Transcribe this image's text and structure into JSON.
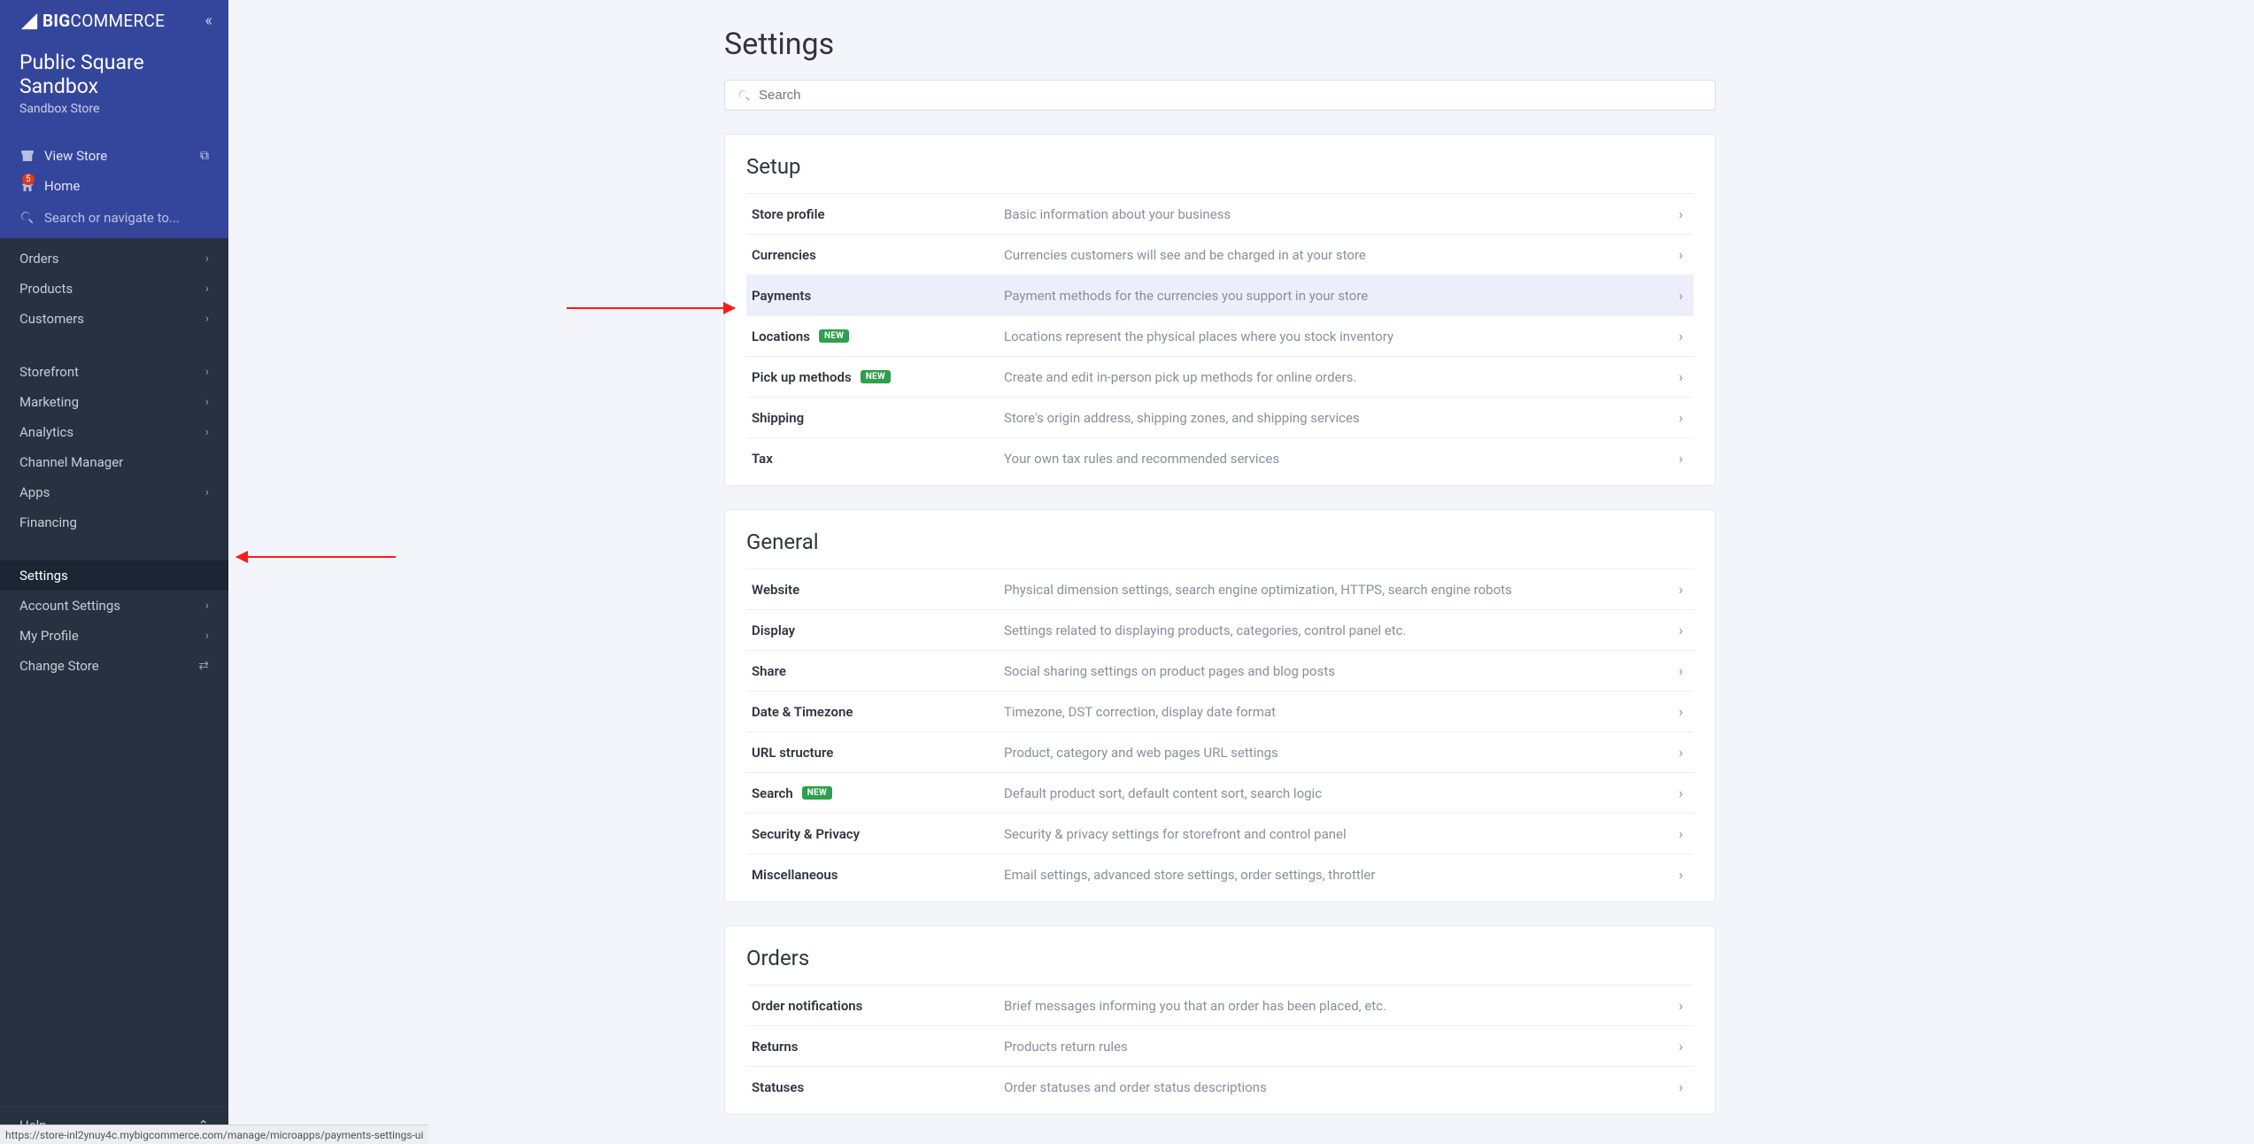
{
  "brand": {
    "big": "BIG",
    "commerce": "COMMERCE"
  },
  "store": {
    "title": "Public Square Sandbox",
    "sub": "Sandbox Store"
  },
  "side_links": {
    "view_store": "View Store",
    "home": "Home",
    "home_badge": "5",
    "search_placeholder": "Search or navigate to..."
  },
  "nav_group1": [
    {
      "label": "Orders",
      "expandable": true
    },
    {
      "label": "Products",
      "expandable": true
    },
    {
      "label": "Customers",
      "expandable": true
    }
  ],
  "nav_group2": [
    {
      "label": "Storefront",
      "expandable": true
    },
    {
      "label": "Marketing",
      "expandable": true
    },
    {
      "label": "Analytics",
      "expandable": true
    },
    {
      "label": "Channel Manager",
      "expandable": false
    },
    {
      "label": "Apps",
      "expandable": true
    },
    {
      "label": "Financing",
      "expandable": false
    }
  ],
  "nav_group3": [
    {
      "label": "Settings",
      "expandable": false,
      "active": true
    },
    {
      "label": "Account Settings",
      "expandable": true
    },
    {
      "label": "My Profile",
      "expandable": true
    },
    {
      "label": "Change Store",
      "expandable": false,
      "swap": true
    }
  ],
  "help_label": "Help",
  "page_title": "Settings",
  "search_placeholder": "Search",
  "sections": [
    {
      "title": "Setup",
      "rows": [
        {
          "label": "Store profile",
          "desc": "Basic information about your business"
        },
        {
          "label": "Currencies",
          "desc": "Currencies customers will see and be charged in at your store"
        },
        {
          "label": "Payments",
          "desc": "Payment methods for the currencies you support in your store",
          "highlight": true
        },
        {
          "label": "Locations",
          "desc": "Locations represent the physical places where you stock inventory",
          "new": true
        },
        {
          "label": "Pick up methods",
          "desc": "Create and edit in-person pick up methods for online orders.",
          "new": true
        },
        {
          "label": "Shipping",
          "desc": "Store's origin address, shipping zones, and shipping services"
        },
        {
          "label": "Tax",
          "desc": "Your own tax rules and recommended services"
        }
      ]
    },
    {
      "title": "General",
      "rows": [
        {
          "label": "Website",
          "desc": "Physical dimension settings, search engine optimization, HTTPS, search engine robots"
        },
        {
          "label": "Display",
          "desc": "Settings related to displaying products, categories, control panel etc."
        },
        {
          "label": "Share",
          "desc": "Social sharing settings on product pages and blog posts"
        },
        {
          "label": "Date & Timezone",
          "desc": "Timezone, DST correction, display date format"
        },
        {
          "label": "URL structure",
          "desc": "Product, category and web pages URL settings"
        },
        {
          "label": "Search",
          "desc": "Default product sort, default content sort, search logic",
          "new": true
        },
        {
          "label": "Security & Privacy",
          "desc": "Security & privacy settings for storefront and control panel"
        },
        {
          "label": "Miscellaneous",
          "desc": "Email settings, advanced store settings, order settings, throttler"
        }
      ]
    },
    {
      "title": "Orders",
      "rows": [
        {
          "label": "Order notifications",
          "desc": "Brief messages informing you that an order has been placed, etc."
        },
        {
          "label": "Returns",
          "desc": "Products return rules"
        },
        {
          "label": "Statuses",
          "desc": "Order statuses and order status descriptions"
        }
      ]
    }
  ],
  "badge_new_label": "NEW",
  "status_url": "https://store-inl2ynuy4c.mybigcommerce.com/manage/microapps/payments-settings-ui"
}
